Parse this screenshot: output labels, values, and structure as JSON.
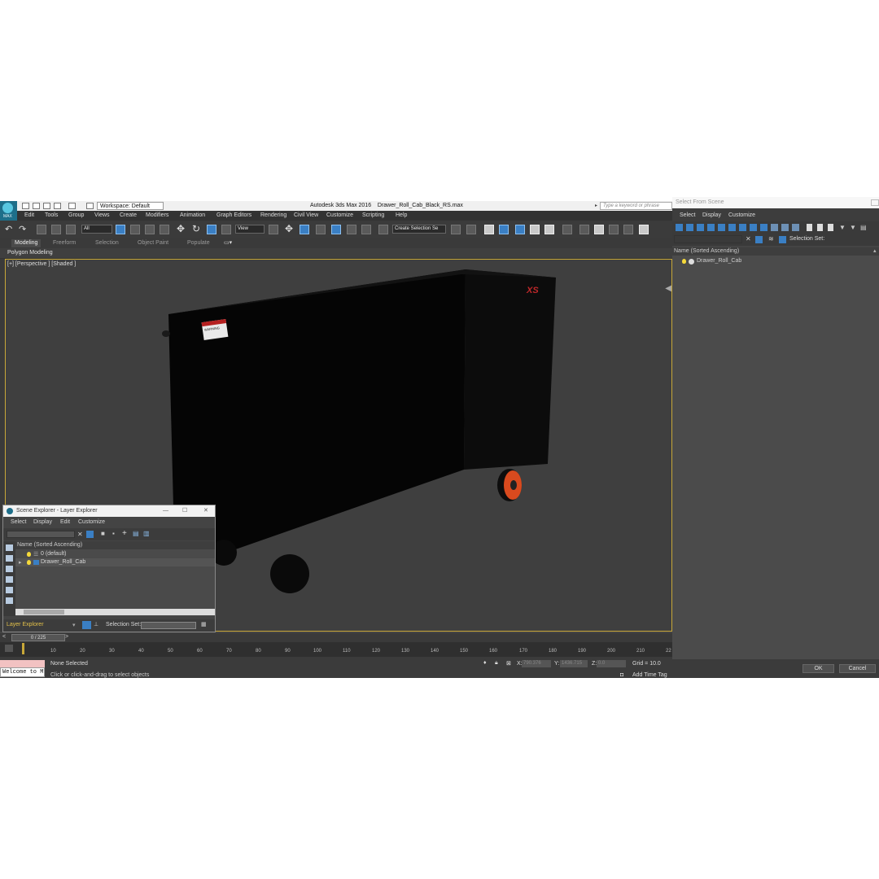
{
  "app": {
    "title": "Autodesk 3ds Max 2016",
    "file_name": "Drawer_Roll_Cab_Black_RS.max",
    "logo_text": "MAX",
    "workspace": "Workspace: Default",
    "search_placeholder": "Type a keyword or phrase"
  },
  "menubar": {
    "items": [
      "Edit",
      "Tools",
      "Group",
      "Views",
      "Create",
      "Modifiers",
      "Animation",
      "Graph Editors",
      "Rendering",
      "Civil View",
      "Customize",
      "Scripting",
      "Help"
    ]
  },
  "toolbar": {
    "filter_value": "All",
    "ref_coord_value": "View",
    "selection_set_value": "Create Selection Se"
  },
  "ribbon": {
    "tabs": [
      "Modeling",
      "Freeform",
      "Selection",
      "Object Paint",
      "Populate"
    ],
    "active_tab": "Modeling",
    "panel_label": "Polygon Modeling"
  },
  "viewport": {
    "label": "[+] [Perspective ] [Shaded ]",
    "object_brand": "XS",
    "warning_label": "WARNING"
  },
  "scene_explorer": {
    "title": "Scene Explorer - Layer Explorer",
    "menu": [
      "Select",
      "Display",
      "Edit",
      "Customize"
    ],
    "column_header": "Name (Sorted Ascending)",
    "rows": [
      "0 (default)",
      "Drawer_Roll_Cab"
    ],
    "explorer_name": "Layer Explorer",
    "selection_set_label": "Selection Set:"
  },
  "timeline": {
    "frame_display": "0 / 225",
    "ticks": [
      "10",
      "20",
      "30",
      "40",
      "50",
      "60",
      "70",
      "80",
      "90",
      "100",
      "110",
      "120",
      "130",
      "140",
      "150",
      "160",
      "170",
      "180",
      "190",
      "200",
      "210",
      "22"
    ]
  },
  "status": {
    "maxscript": "Welcome to M",
    "selection": "None Selected",
    "prompt": "Click or click-and-drag to select objects",
    "x_label": "X:",
    "x_value": "790.376",
    "y_label": "Y:",
    "y_value": "1436.715",
    "z_label": "Z:",
    "z_value": "0.0",
    "grid": "Grid = 10.0",
    "add_time_tag": "Add Time Tag"
  },
  "select_from_scene": {
    "title": "Select From Scene",
    "menu": [
      "Select",
      "Display",
      "Customize"
    ],
    "selection_set_label": "Selection Set:",
    "column_header": "Name (Sorted Ascending)",
    "rows": [
      "Drawer_Roll_Cab"
    ],
    "ok_label": "OK",
    "cancel_label": "Cancel"
  },
  "colors": {
    "accent": "#3a7fc4",
    "viewport_border": "#c8a838",
    "wheel_orange": "#d94a1e",
    "brand_red": "#c0282a"
  }
}
